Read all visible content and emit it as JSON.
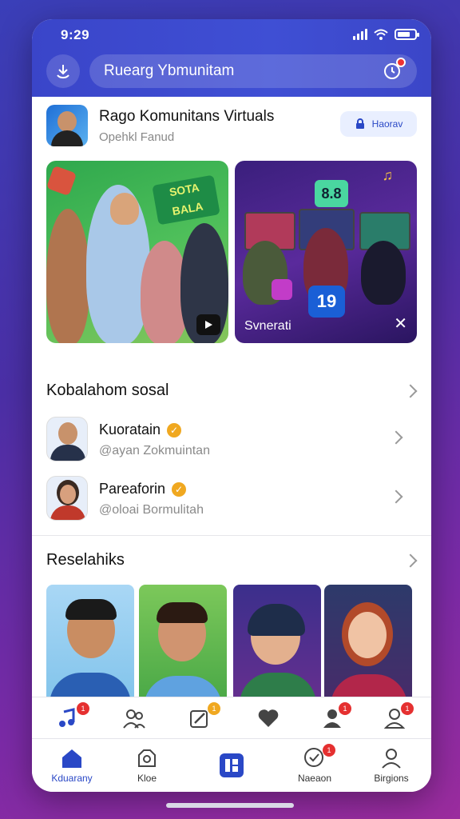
{
  "status": {
    "time": "9:29",
    "battery_level": 0.75
  },
  "header": {
    "search_text": "Ruearg Ybmunitam"
  },
  "community": {
    "title": "Rago Komunitans Virtuals",
    "subtitle": "Opehkl Fanud",
    "follow_label": "Haorav"
  },
  "media": {
    "left_sign": "SOTA\nBALA",
    "right_caption": "Svnerati",
    "right_score": "8.8",
    "right_num": "19"
  },
  "social": {
    "section_title": "Kobalahom sosal",
    "items": [
      {
        "name": "Kuoratain",
        "handle": "@ayan Zokmuintan"
      },
      {
        "name": "Pareaforin",
        "handle": "@oloai Bormulitah"
      }
    ]
  },
  "reels": {
    "section_title": "Reselahiks"
  },
  "tabs_top": [
    {
      "icon": "music-icon",
      "badge": "1"
    },
    {
      "icon": "people-icon",
      "badge": ""
    },
    {
      "icon": "edit-icon",
      "badge": "1"
    },
    {
      "icon": "heart-icon",
      "badge": ""
    },
    {
      "icon": "person-icon",
      "badge": "1"
    },
    {
      "icon": "user-icon",
      "badge": "1"
    }
  ],
  "tabs_bottom": [
    {
      "label": "Kduarany",
      "icon": "home-icon"
    },
    {
      "label": "Kloe",
      "icon": "camera-icon"
    },
    {
      "label": "",
      "icon": "app-icon"
    },
    {
      "label": "Naeaon",
      "icon": "chat-icon",
      "badge": "1"
    },
    {
      "label": "Birgions",
      "icon": "profile-icon"
    }
  ],
  "colors": {
    "brand": "#3f4fd4",
    "accent_badge": "#e53030",
    "verified": "#f0a820"
  }
}
